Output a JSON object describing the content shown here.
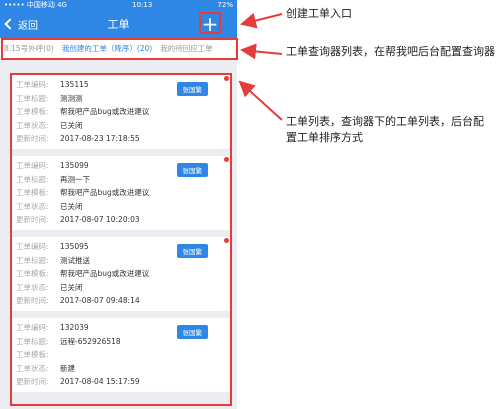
{
  "status": {
    "carrier": "••••• 中国移动 4G",
    "time": "10:13",
    "battery": "72%"
  },
  "nav": {
    "back": "返回",
    "title": "工单",
    "add": "+"
  },
  "tabs": [
    "8.15号外呼(0)",
    "我创建的工单（降序）(20)",
    "我的待回应工单"
  ],
  "list": [
    {
      "labels": [
        "工单编码:",
        "工单标题:",
        "工单模板:",
        "工单状态:",
        "更新时间:"
      ],
      "code": "135115",
      "title": "测测测",
      "template": "帮我吧产品bug或改进建议",
      "status": "已关闭",
      "time": "2017-08-23 17:18:55",
      "badge": "张国繁"
    },
    {
      "labels": [
        "工单编码:",
        "工单标题:",
        "工单模板:",
        "工单状态:",
        "更新时间:"
      ],
      "code": "135099",
      "title": "再测一下",
      "template": "帮我吧产品bug或改进建议",
      "status": "已关闭",
      "time": "2017-08-07 10:20:03",
      "badge": "张国繁"
    },
    {
      "labels": [
        "工单编码:",
        "工单标题:",
        "工单模板:",
        "工单状态:",
        "更新时间:"
      ],
      "code": "135095",
      "title": "测试推送",
      "template": "帮我吧产品bug或改进建议",
      "status": "已关闭",
      "time": "2017-08-07 09:48:14",
      "badge": "张国繁"
    },
    {
      "labels": [
        "工单编码:",
        "工单标题:",
        "工单模板:",
        "工单状态:",
        "更新时间:"
      ],
      "code": "132039",
      "title": "远程-652926518",
      "template": "",
      "status": "新建",
      "time": "2017-08-04 15:17:59",
      "badge": "张国繁"
    }
  ],
  "annotations": {
    "create": "创建工单入口",
    "tabs": "工单查询器列表，在帮我吧后台配置查询器",
    "list": "工单列表，查询器下的工单列表，后台配置工单排序方式"
  },
  "colors": {
    "primary": "#2f87e5",
    "highlight": "#e53b3b"
  }
}
